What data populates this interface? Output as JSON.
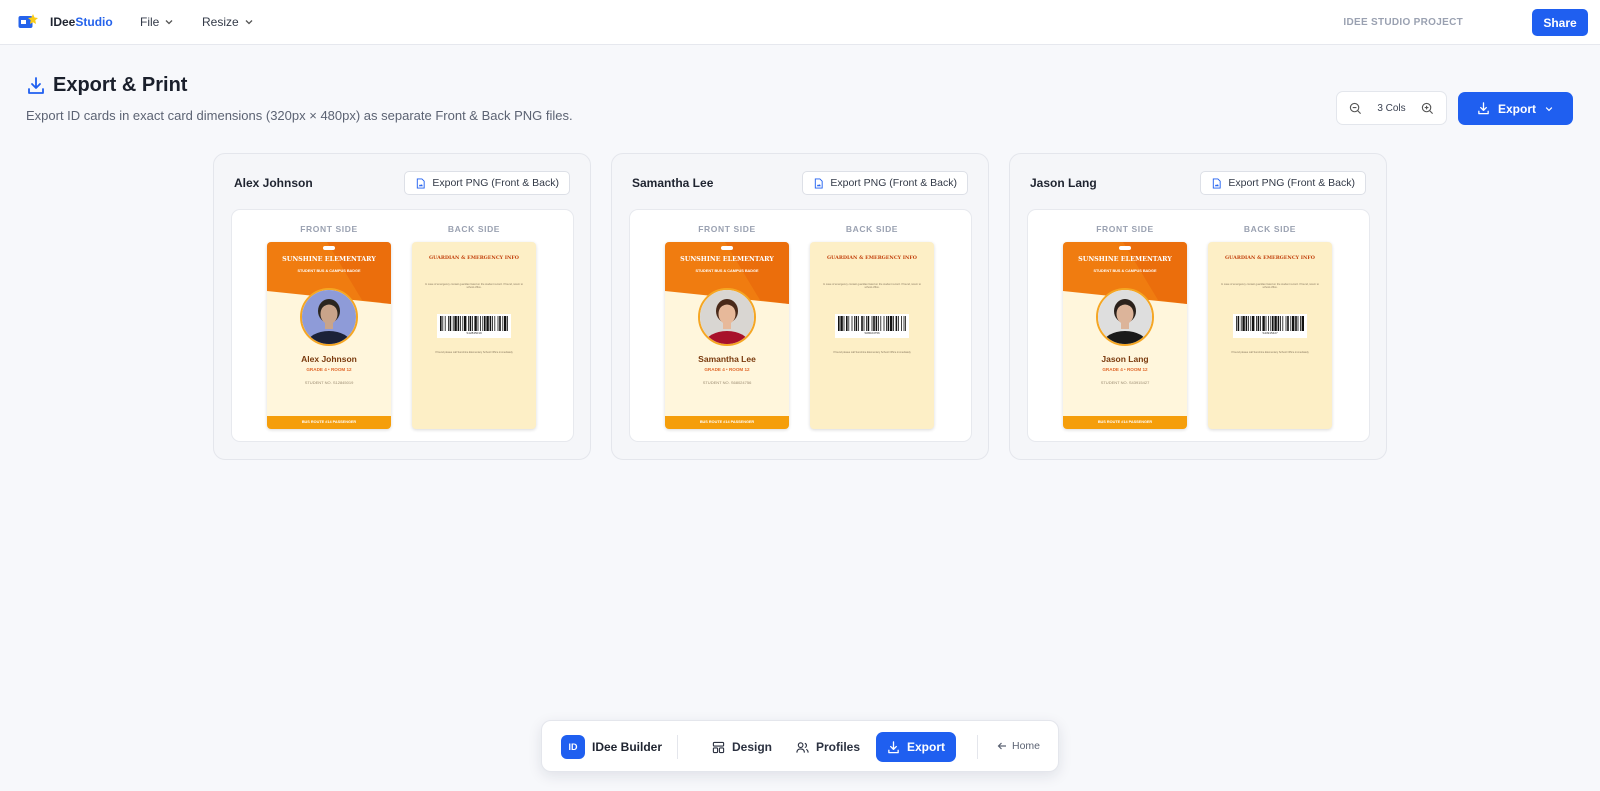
{
  "topbar": {
    "brand_part1": "IDee",
    "brand_part2": "Studio",
    "menus": [
      "File",
      "Resize"
    ],
    "project": "IDEE STUDIO PROJECT",
    "share_label": "Share"
  },
  "page": {
    "title": "Export & Print",
    "description": "Export ID cards in exact card dimensions (320px × 480px) as separate Front & Back PNG files.",
    "zoom_label": "3 Cols",
    "export_label": "Export"
  },
  "colors": {
    "accent": "#1f5ff0",
    "card_orange": "#f07c10",
    "card_amber": "#f59e0b",
    "card_cream": "#fff6dc"
  },
  "profiles": [
    {
      "name": "Alex Johnson",
      "export_label": "Export PNG (Front & Back)",
      "front_label": "FRONT SIDE",
      "back_label": "BACK SIDE",
      "school": "SUNSHINE ELEMENTARY",
      "subtitle": "STUDENT BUS & CAMPUS BADGE",
      "card_name": "Alex Johnson",
      "grade": "GRADE 4 • ROOM 12",
      "student_no": "STUDENT NO. S12845019",
      "footer": "BUS ROUTE #14 PASSENGER",
      "back_title": "GUARDIAN & EMERGENCY INFO",
      "back_line": "In case of emergency contact guardian listed on the student record. If found, return to school office.",
      "barcode_number": "S12845019",
      "back_note": "If found please call Sunshine Elementary School Office immediately",
      "photo_hair": "#2b2620",
      "photo_skin": "#c9a48a",
      "photo_shirt": "#1c2238",
      "photo_bg": "#8e9bd8"
    },
    {
      "name": "Samantha Lee",
      "export_label": "Export PNG (Front & Back)",
      "front_label": "FRONT SIDE",
      "back_label": "BACK SIDE",
      "school": "SUNSHINE ELEMENTARY",
      "subtitle": "STUDENT BUS & CAMPUS BADGE",
      "card_name": "Samantha Lee",
      "grade": "GRADE 4 • ROOM 12",
      "student_no": "STUDENT NO. S68024756",
      "footer": "BUS ROUTE #14 PASSENGER",
      "back_title": "GUARDIAN & EMERGENCY INFO",
      "back_line": "In case of emergency contact guardian listed on the student record. If found, return to school office.",
      "barcode_number": "S68024756",
      "back_note": "If found please call Sunshine Elementary School Office immediately",
      "photo_hair": "#4a2a1a",
      "photo_skin": "#e7b99a",
      "photo_shirt": "#a8112a",
      "photo_bg": "#d9d6d2"
    },
    {
      "name": "Jason Lang",
      "export_label": "Export PNG (Front & Back)",
      "front_label": "FRONT SIDE",
      "back_label": "BACK SIDE",
      "school": "SUNSHINE ELEMENTARY",
      "subtitle": "STUDENT BUS & CAMPUS BADGE",
      "card_name": "Jason Lang",
      "grade": "GRADE 4 • ROOM 12",
      "student_no": "STUDENT NO. S43915427",
      "footer": "BUS ROUTE #14 PASSENGER",
      "back_title": "GUARDIAN & EMERGENCY INFO",
      "back_line": "In case of emergency contact guardian listed on the student record. If found, return to school office.",
      "barcode_number": "S43915427",
      "back_note": "If found please call Sunshine Elementary School Office immediately",
      "photo_hair": "#2a211b",
      "photo_skin": "#dcb49a",
      "photo_shirt": "#1a1a1a",
      "photo_bg": "#dedede"
    }
  ],
  "dock": {
    "logo_text": "ID",
    "brand": "IDee Builder",
    "items": [
      "Design",
      "Profiles",
      "Export"
    ],
    "home_label": "Home"
  }
}
